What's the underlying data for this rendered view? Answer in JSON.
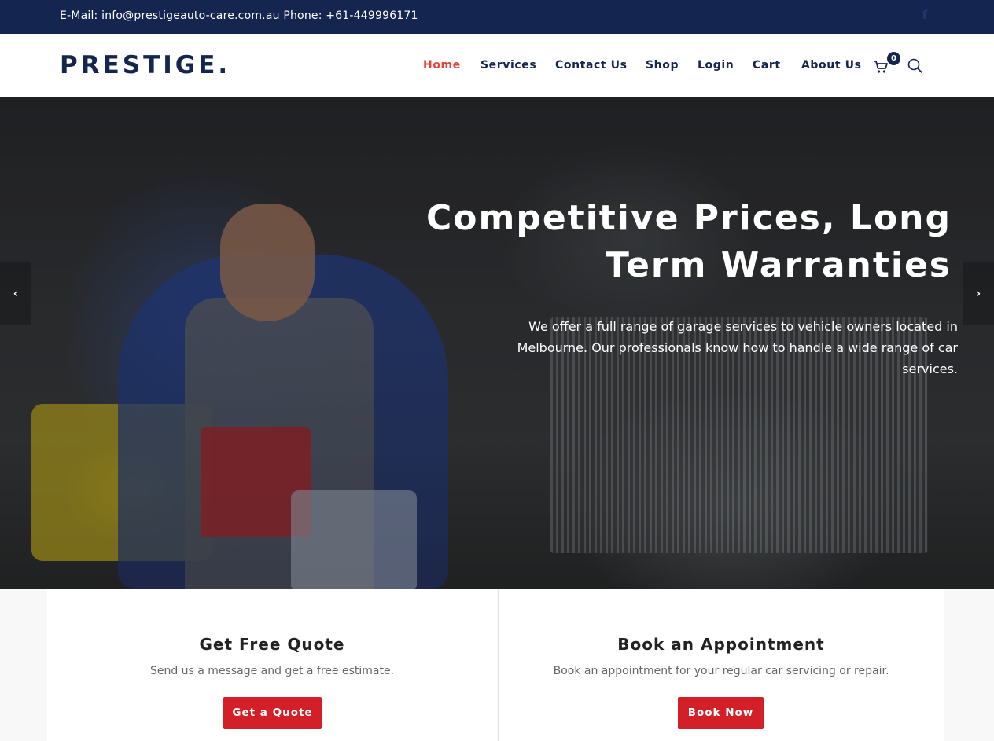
{
  "topbar": {
    "contact_text": "E-Mail: info@prestigeauto-care.com.au Phone: +61-449996171",
    "social_icon": "facebook-icon",
    "social_glyph": "f"
  },
  "header": {
    "logo": "PRESTIGE.",
    "nav": [
      {
        "label": "Home",
        "active": true
      },
      {
        "label": "Services",
        "active": false
      },
      {
        "label": "Contact Us",
        "active": false
      },
      {
        "label": "Shop",
        "active": false
      },
      {
        "label": "Login",
        "active": false
      },
      {
        "label": "Cart",
        "active": false
      },
      {
        "label": "About Us",
        "active": false
      }
    ],
    "cart_count": "0",
    "cart_icon": "cart-icon",
    "search_icon": "search-icon"
  },
  "hero": {
    "title_line1": "Competitive Prices, Long",
    "title_line2": "Term Warranties",
    "description": "We offer a full range of garage services to vehicle owners located in Melbourne. Our professionals know how to handle a wide range of car services.",
    "prev_glyph": "‹",
    "next_glyph": "›"
  },
  "features": [
    {
      "title": "Get Free Quote",
      "description": "Send us a message and get a free estimate.",
      "button": "Get a Quote"
    },
    {
      "title": "Book an Appointment",
      "description": "Book an appointment for your regular car servicing or repair.",
      "button": "Book Now"
    }
  ],
  "colors": {
    "brand_navy": "#14254f",
    "accent_red": "#d32028",
    "active_nav": "#e0443a"
  }
}
